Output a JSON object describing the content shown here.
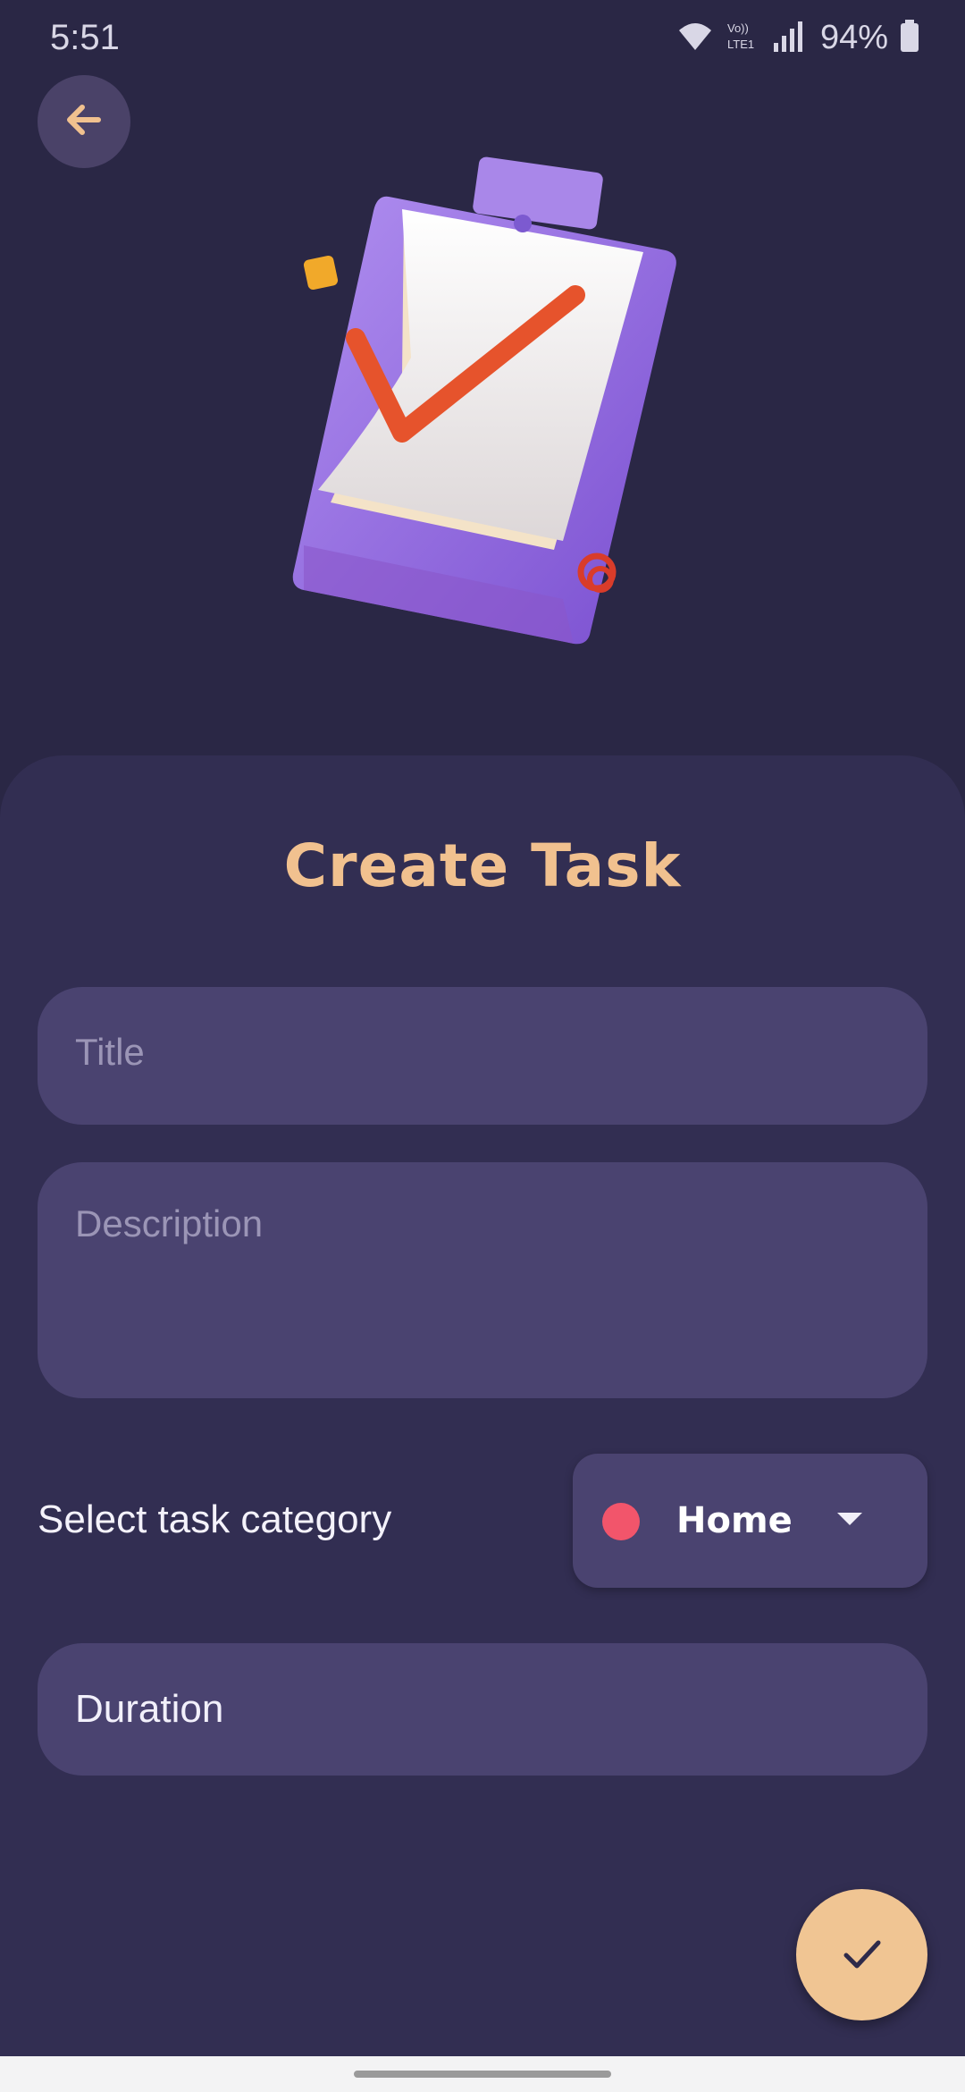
{
  "status_bar": {
    "time": "5:51",
    "battery": "94%",
    "lte_label": "Vo)) LTE1"
  },
  "header": {
    "back_icon": "arrow-left-icon",
    "illustration": "clipboard-checkmark-illustration"
  },
  "form": {
    "title": "Create Task",
    "title_placeholder": "Title",
    "description_placeholder": "Description",
    "category_label": "Select task category",
    "category_value": "Home",
    "category_color": "#f2556b",
    "duration_label": "Duration"
  },
  "fab": {
    "icon": "checkmark-icon"
  },
  "colors": {
    "background": "#2a2745",
    "sheet": "#322e52",
    "field": "#4a4370",
    "accent": "#f0c593"
  }
}
